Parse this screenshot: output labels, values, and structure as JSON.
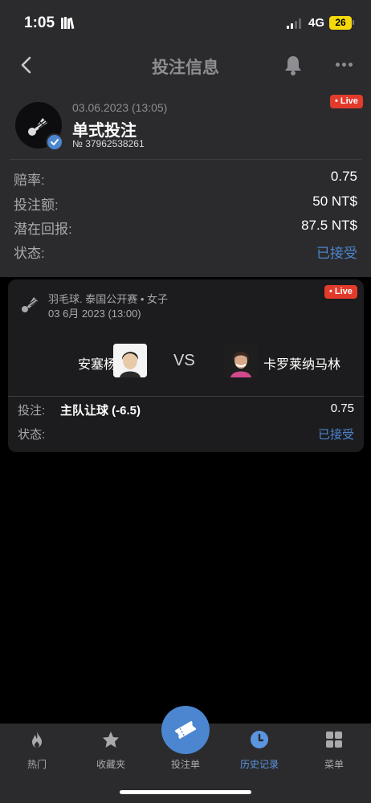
{
  "status_bar": {
    "time": "1:05",
    "network": "4G",
    "battery": "26"
  },
  "nav": {
    "title": "投注信息"
  },
  "bet": {
    "date": "03.06.2023 (13:05)",
    "type": "单式投注",
    "number": "№ 37962538261",
    "live_label": "• Live",
    "rows": [
      {
        "label": "赔率:",
        "value": "0.75"
      },
      {
        "label": "投注额:",
        "value": "50 NT$"
      },
      {
        "label": "潜在回报:",
        "value": "87.5 NT$"
      },
      {
        "label": "状态:",
        "value": "已接受"
      }
    ]
  },
  "event": {
    "live_label": "• Live",
    "league": "羽毛球. 泰国公开赛 • 女子",
    "date": "03 6月 2023 (13:00)",
    "home_name": "安塞杨",
    "vs": "VS",
    "away_name": "卡罗莱纳马林",
    "bet_label": "投注:",
    "bet_market": "主队让球 (-6.5)",
    "bet_odds": "0.75",
    "status_label": "状态:",
    "status_value": "已接受"
  },
  "tabs": [
    {
      "label": "热门",
      "icon": "fire-icon"
    },
    {
      "label": "收藏夹",
      "icon": "star-icon"
    },
    {
      "label": "投注单",
      "icon": "ticket-icon"
    },
    {
      "label": "历史记录",
      "icon": "clock-icon",
      "active": true
    },
    {
      "label": "菜单",
      "icon": "grid-icon"
    }
  ],
  "colors": {
    "accent": "#4c86d0",
    "live": "#e23b2c",
    "battery": "#f5d90a",
    "panel": "#2b2b2d",
    "card": "#1c1c1e"
  }
}
